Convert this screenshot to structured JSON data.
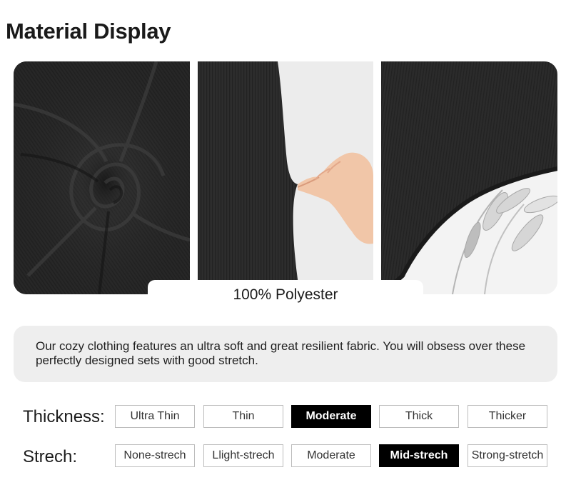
{
  "heading": "Material Display",
  "material": "100% Polyester",
  "description": "Our cozy clothing features an ultra soft and great resilient fabric. You will obsess over these perfectly designed sets with good stretch.",
  "thickness": {
    "label": "Thickness:",
    "options": [
      "Ultra Thin",
      "Thin",
      "Moderate",
      "Thick",
      "Thicker"
    ],
    "selected": "Moderate"
  },
  "stretch": {
    "label": "Strech:",
    "options": [
      "None-strech",
      "Llight-strech",
      "Moderate",
      "Mid-strech",
      "Strong-stretch"
    ],
    "selected": "Mid-strech"
  },
  "colors": {
    "fabric": "#2a2a2a",
    "selected_bg": "#000000",
    "description_bg": "#eeeeee"
  }
}
